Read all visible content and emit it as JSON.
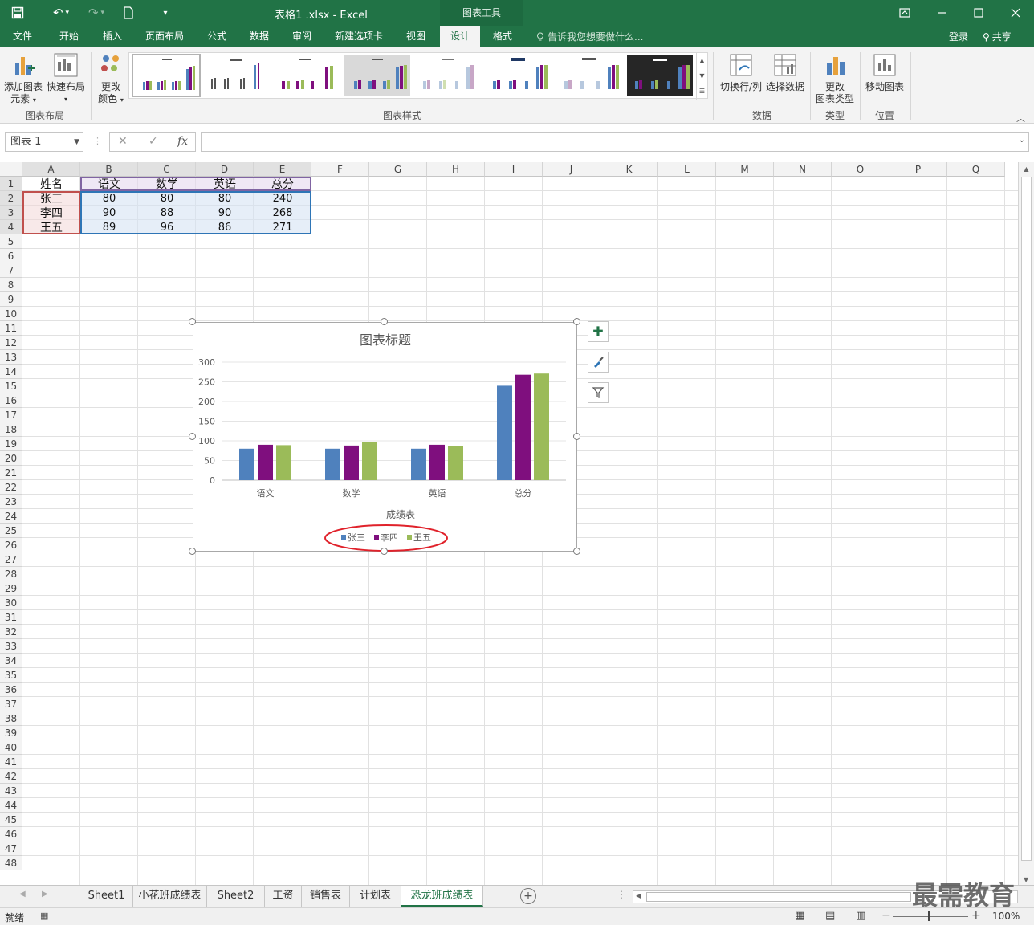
{
  "title": {
    "file_name": "表格1 .xlsx - Excel",
    "tool_tab": "图表工具"
  },
  "tabs": [
    "文件",
    "开始",
    "插入",
    "页面布局",
    "公式",
    "数据",
    "审阅",
    "新建选项卡",
    "视图",
    "设计",
    "格式"
  ],
  "active_tab": "设计",
  "tell_me": "告诉我您想要做什么...",
  "account": {
    "login": "登录",
    "share": "共享"
  },
  "ribbon": {
    "add_element": "添加图表元素",
    "add_element_line1": "添加图表",
    "add_element_line2": "元素",
    "quick_layout": "快速布局",
    "group_layout": "图表布局",
    "change_color_line1": "更改",
    "change_color_line2": "颜色",
    "group_styles": "图表样式",
    "switch_row_col": "切换行/列",
    "select_data": "选择数据",
    "group_data": "数据",
    "change_type_line1": "更改",
    "change_type_line2": "图表类型",
    "group_type": "类型",
    "move_chart": "移动图表",
    "group_location": "位置"
  },
  "formula_bar": {
    "name_box": "图表 1",
    "fx": "fx",
    "value": ""
  },
  "columns": [
    "A",
    "B",
    "C",
    "D",
    "E",
    "F",
    "G",
    "H",
    "I",
    "J",
    "K",
    "L",
    "M",
    "N",
    "O",
    "P",
    "Q"
  ],
  "rows": [
    "1",
    "2",
    "3",
    "4",
    "5",
    "6",
    "7",
    "8",
    "9",
    "10",
    "11",
    "12",
    "13",
    "14",
    "15",
    "16",
    "17",
    "18",
    "19",
    "20",
    "21",
    "22",
    "23",
    "24",
    "25",
    "26",
    "27",
    "28",
    "29",
    "30",
    "31",
    "32",
    "33",
    "34",
    "35",
    "36",
    "37",
    "38",
    "39",
    "40",
    "41",
    "42",
    "43",
    "44",
    "45",
    "46",
    "47",
    "48"
  ],
  "table": {
    "header": [
      "姓名",
      "语文",
      "数学",
      "英语",
      "总分"
    ],
    "rows": [
      [
        "张三",
        "80",
        "80",
        "80",
        "240"
      ],
      [
        "李四",
        "90",
        "88",
        "90",
        "268"
      ],
      [
        "王五",
        "89",
        "96",
        "86",
        "271"
      ]
    ]
  },
  "chart_data": {
    "type": "bar",
    "title": "图表标题",
    "xlabel": "成绩表",
    "ylabel": "",
    "categories": [
      "语文",
      "数学",
      "英语",
      "总分"
    ],
    "series": [
      {
        "name": "张三",
        "values": [
          80,
          80,
          80,
          240
        ],
        "color": "#4f81bd"
      },
      {
        "name": "李四",
        "values": [
          90,
          88,
          90,
          268
        ],
        "color": "#7f0f7e"
      },
      {
        "name": "王五",
        "values": [
          89,
          96,
          86,
          271
        ],
        "color": "#9bbb59"
      }
    ],
    "ylim": [
      0,
      300
    ],
    "yticks": [
      0,
      50,
      100,
      150,
      200,
      250,
      300
    ],
    "grid": true,
    "legend_position": "bottom"
  },
  "sheets": [
    "Sheet1",
    "小花班成绩表",
    "Sheet2",
    "工资",
    "销售表",
    "计划表",
    "恐龙班成绩表"
  ],
  "active_sheet": "恐龙班成绩表",
  "status": {
    "ready": "就绪",
    "zoom": "100%"
  },
  "watermark": "最需教育"
}
